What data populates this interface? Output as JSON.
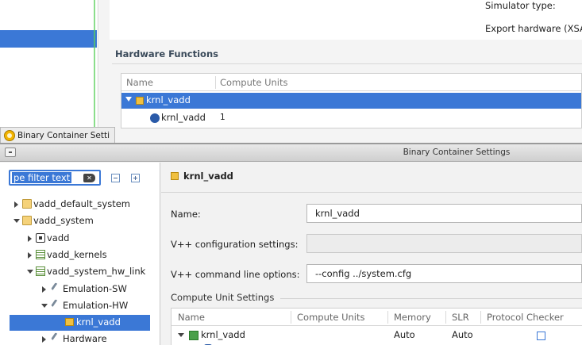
{
  "background": {
    "simulator_type_label": "Simulator type:",
    "export_hardware_label": "Export hardware (XSA",
    "hardware_functions_title": "Hardware Functions",
    "hw_table": {
      "col_name": "Name",
      "col_compute_units": "Compute Units",
      "rows": [
        {
          "name": "krnl_vadd",
          "compute_units": ""
        },
        {
          "name": "krnl_vadd",
          "compute_units": "1"
        }
      ]
    },
    "tab_label": "Binary Container Setti"
  },
  "dialog": {
    "title": "Binary Container Settings",
    "filter": {
      "value": "pe filter text"
    },
    "tree": [
      {
        "label": "vadd_default_system"
      },
      {
        "label": "vadd_system"
      },
      {
        "label": "vadd"
      },
      {
        "label": "vadd_kernels"
      },
      {
        "label": "vadd_system_hw_link"
      },
      {
        "label": "Emulation-SW"
      },
      {
        "label": "Emulation-HW"
      },
      {
        "label": "krnl_vadd"
      },
      {
        "label": "Hardware"
      }
    ],
    "content": {
      "section_title": "krnl_vadd",
      "name_label": "Name:",
      "name_value": "krnl_vadd",
      "vpp_config_label": "V++ configuration settings:",
      "vpp_config_value": "",
      "vpp_cmd_label": "V++ command line options:",
      "vpp_cmd_value": "--config ../system.cfg",
      "cu_settings_title": "Compute Unit Settings",
      "cu_table": {
        "headers": [
          "Name",
          "Compute Units",
          "Memory",
          "SLR",
          "Protocol Checker"
        ],
        "rows": [
          {
            "name": "krnl_vadd",
            "compute_units": "",
            "memory": "Auto",
            "slr": "Auto",
            "protocol_checker": false
          }
        ]
      }
    }
  }
}
